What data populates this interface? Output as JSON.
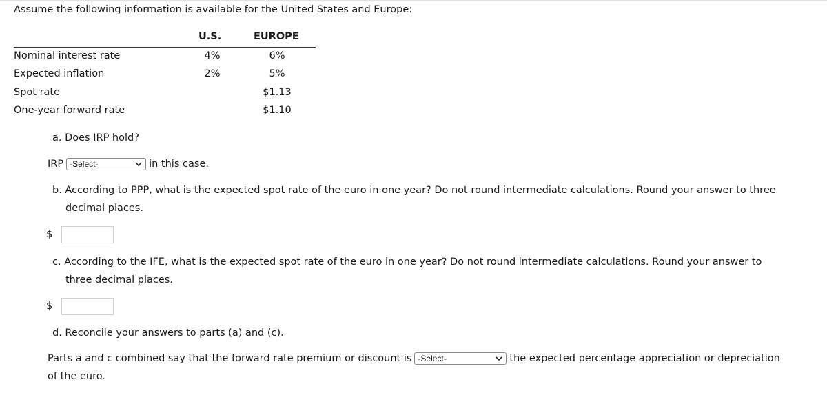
{
  "intro": "Assume the following information is available for the United States and Europe:",
  "table": {
    "headers": [
      "",
      "U.S.",
      "EUROPE"
    ],
    "rows": [
      {
        "label": "Nominal interest rate",
        "us": "4%",
        "europe": "6%"
      },
      {
        "label": "Expected inflation",
        "us": "2%",
        "europe": "5%"
      },
      {
        "label": "Spot rate",
        "us": "",
        "europe": "$1.13"
      },
      {
        "label": "One-year forward rate",
        "us": "",
        "europe": "$1.10"
      }
    ]
  },
  "part_a": {
    "question": "a. Does IRP hold?",
    "prefix": "IRP",
    "select_value": "-Select-",
    "suffix": "in this case."
  },
  "part_b": {
    "question_line1": "b. According to PPP, what is the expected spot rate of the euro in one year? Do not round intermediate calculations. Round your answer to three",
    "question_line2": "decimal places.",
    "currency": "$",
    "answer": ""
  },
  "part_c": {
    "question_line1": "c. According to the IFE, what is the expected spot rate of the euro in one year? Do not round intermediate calculations. Round your answer to",
    "question_line2": "three decimal places.",
    "currency": "$",
    "answer": ""
  },
  "part_d": {
    "question": "d. Reconcile your answers to parts (a) and (c).",
    "prefix": "Parts a and c combined say that the forward rate premium or discount is",
    "select_value": "-Select-",
    "suffix": "the expected percentage appreciation or depreciation",
    "suffix_line2": "of the euro."
  }
}
